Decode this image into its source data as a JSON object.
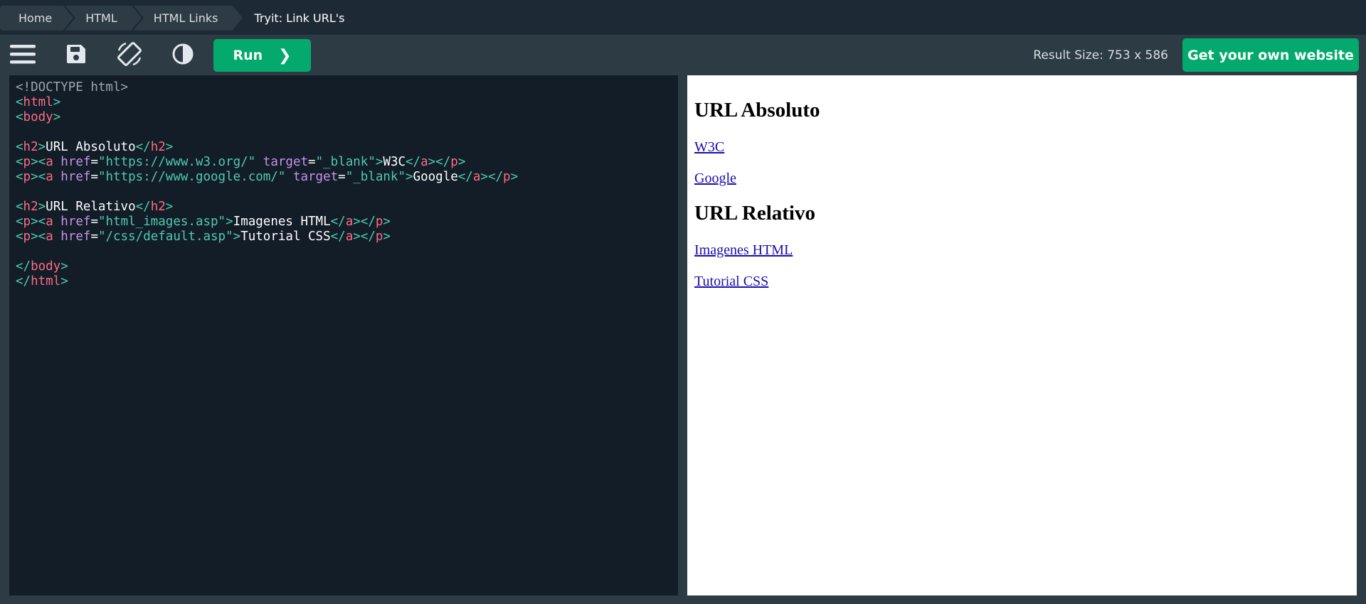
{
  "breadcrumb": {
    "items": [
      {
        "label": "Home"
      },
      {
        "label": "HTML"
      },
      {
        "label": "HTML Links"
      },
      {
        "label": "Tryit: Link URL's"
      }
    ]
  },
  "toolbar": {
    "menu_icon": "hamburger-menu-icon",
    "save_icon": "floppy-disk-icon",
    "rotate_icon": "rotate-layout-icon",
    "theme_icon": "contrast-icon",
    "run_label": "Run",
    "run_arrow": "❯",
    "result_size": "Result Size: 753 x 586",
    "own_website_label": "Get your own website"
  },
  "colors": {
    "accent": "#04aa6d",
    "bar": "#1d2a35",
    "toolbar": "#2d3b45",
    "editor_bg": "#131d28"
  },
  "editor": {
    "lines": [
      "<!DOCTYPE html>",
      "<html>",
      "<body>",
      "",
      "<h2>URL Absoluto</h2>",
      "<p><a href=\"https://www.w3.org/\" target=\"_blank\">W3C</a></p>",
      "<p><a href=\"https://www.google.com/\" target=\"_blank\">Google</a></p>",
      "",
      "<h2>URL Relativo</h2>",
      "<p><a href=\"html_images.asp\">Imagenes HTML</a></p>",
      "<p><a href=\"/css/default.asp\">Tutorial CSS</a></p>",
      "",
      "</body>",
      "</html>"
    ]
  },
  "result": {
    "heading1": "URL Absoluto",
    "link1": "W3C",
    "link2": "Google",
    "heading2": "URL Relativo",
    "link3": "Imagenes HTML",
    "link4": "Tutorial CSS"
  }
}
